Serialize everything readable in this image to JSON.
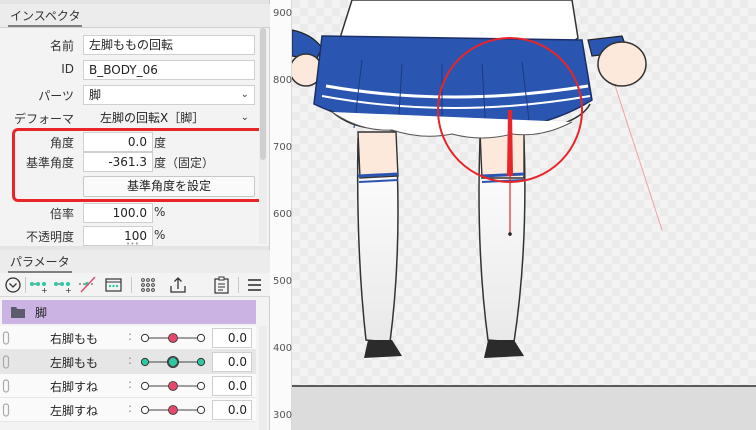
{
  "inspector": {
    "tab_label": "インスペクタ",
    "fields": {
      "name_label": "名前",
      "name_value": "左脚ももの回転",
      "id_label": "ID",
      "id_value": "B_BODY_06",
      "parts_label": "パーツ",
      "parts_value": "脚",
      "deformer_label": "デフォーマ",
      "deformer_value": "左脚の回転X［脚］",
      "angle_label": "角度",
      "angle_value": "0.0",
      "angle_unit": "度",
      "base_angle_label": "基準角度",
      "base_angle_value": "-361.3",
      "base_angle_unit": "度（固定）",
      "set_base_button": "基準角度を設定",
      "scale_label": "倍率",
      "scale_value": "100.0",
      "scale_unit": "%",
      "opacity_label": "不透明度",
      "opacity_value": "100",
      "opacity_unit": "%"
    }
  },
  "parameters": {
    "tab_label": "パラメータ",
    "group_label": "脚",
    "rows": [
      {
        "label": "右脚もも",
        "colon": ":",
        "value": "0.0",
        "knob_position": 0.5,
        "active": false
      },
      {
        "label": "左脚もも",
        "colon": ":",
        "value": "0.0",
        "knob_position": 0.5,
        "active": true
      },
      {
        "label": "右脚すね",
        "colon": ":",
        "value": "0.0",
        "knob_position": 0.5,
        "active": false
      },
      {
        "label": "左脚すね",
        "colon": ":",
        "value": "0.0",
        "knob_position": 0.5,
        "active": false
      }
    ]
  },
  "canvas": {
    "ruler_ticks": [
      "900",
      "800",
      "700",
      "600",
      "500",
      "400",
      "300"
    ]
  },
  "colors": {
    "highlight": "#e8262a",
    "group_bg": "#cbb3e3",
    "knob_active": "#2ec9a4",
    "knob_inactive": "#e4486b",
    "skirt_blue": "#2a55b0"
  },
  "icons": {
    "inspector_tab": "tab",
    "parameter_toolbar": [
      "dropdown-circle-icon",
      "add-keys-icon",
      "add-keys-alt-icon",
      "delete-keys-icon",
      "keyform-list-icon",
      "grid-dots-icon",
      "export-icon",
      "clipboard-icon",
      "menu-icon"
    ],
    "group": "folder-icon",
    "row_link": "link-icon"
  }
}
